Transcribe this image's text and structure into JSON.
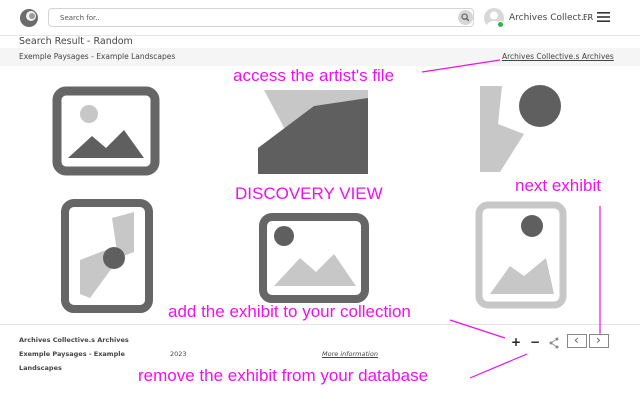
{
  "header": {
    "search_placeholder": "Search for..",
    "username": "Archives Collect...",
    "language": "FR",
    "icons": [
      "logo-icon",
      "search-icon",
      "avatar-icon",
      "hamburger-menu-icon"
    ],
    "online_status_color": "#2fb24c"
  },
  "page": {
    "title": "Search Result - Random",
    "breadcrumb": "Exemple Paysages - Example Landscapes",
    "archives_link": "Archives Collective.s Archives"
  },
  "annotations": {
    "artist_file": "access the artist's file",
    "discovery_view": "DISCOVERY VIEW",
    "next_exhibit": "next exhibit",
    "add_exhibit": "add the exhibit to your collection",
    "remove_exhibit": "remove the exhibit from your database",
    "color": "#ee11ee"
  },
  "footer": {
    "collective": "Archives Collective.s Archives",
    "exhibit_line1": "Exemple Paysages - Example",
    "exhibit_line2": "Landscapes",
    "year": "2023",
    "more_info": "More information",
    "add": "+",
    "remove": "−",
    "share_icon": "share-icon",
    "prev": "‹",
    "next": "›"
  },
  "grid": {
    "items": [
      {
        "icon": "image-placeholder-icon"
      },
      {
        "icon": "image-placeholder-icon"
      },
      {
        "icon": "image-placeholder-icon"
      },
      {
        "icon": "image-placeholder-icon"
      },
      {
        "icon": "image-placeholder-icon"
      },
      {
        "icon": "image-placeholder-icon"
      }
    ]
  }
}
